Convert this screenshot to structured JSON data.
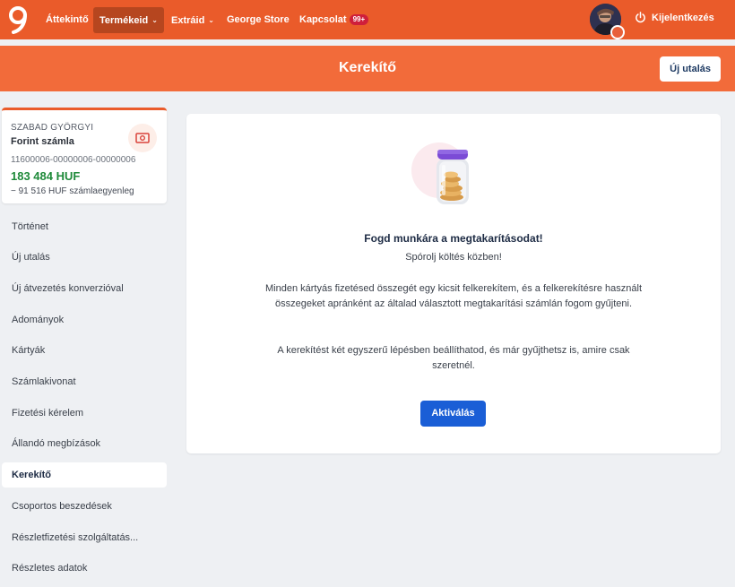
{
  "nav": {
    "items": [
      {
        "label": "Áttekintő"
      },
      {
        "label": "Termékeid"
      },
      {
        "label": "Extráid"
      },
      {
        "label": "George Store"
      },
      {
        "label": "Kapcsolat"
      }
    ],
    "badge": "99+",
    "logout_label": "Kijelentkezés"
  },
  "header": {
    "title": "Kerekítő",
    "new_transfer_label": "Új utalás"
  },
  "account": {
    "owner": "SZABAD GYÖRGYI",
    "name": "Forint számla",
    "number": "11600006-00000006-00000006",
    "balance": "183 484 HUF",
    "sub_balance": "− 91 516 HUF számlaegyenleg"
  },
  "sidebar": {
    "items": [
      {
        "label": "Történet"
      },
      {
        "label": "Új utalás"
      },
      {
        "label": "Új átvezetés konverzióval"
      },
      {
        "label": "Adományok"
      },
      {
        "label": "Kártyák"
      },
      {
        "label": "Számlakivonat"
      },
      {
        "label": "Fizetési kérelem"
      },
      {
        "label": "Állandó megbízások"
      },
      {
        "label": "Kerekítő"
      },
      {
        "label": "Csoportos beszedések"
      },
      {
        "label": "Részletfizetési szolgáltatás..."
      },
      {
        "label": "Részletes adatok"
      }
    ],
    "active_index": 8
  },
  "content": {
    "title": "Fogd munkára a megtakarításodat!",
    "subtitle": "Spórolj költés közben!",
    "paragraph1_line1": "Minden kártyás fizetésed összegét egy kicsit felkerekítem, és a felkerekítésre használt",
    "paragraph1_line2": "összegeket apránként az általad választott megtakarítási számlán fogom gyűjteni.",
    "paragraph2_line1": "A kerekítést két egyszerű lépésben beállíthatod, és már gyűjthetsz is, amire csak",
    "paragraph2_line2": "szeretnél.",
    "activate_label": "Aktiválás"
  },
  "colors": {
    "brand_orange": "#ea5b2a",
    "header_orange": "#f26b3a",
    "primary_button": "#1a5ed6",
    "balance_green": "#1f8a3a"
  },
  "icons": [
    "logo-icon",
    "chevron-down-icon",
    "power-icon",
    "money-icon",
    "jar-icon"
  ]
}
